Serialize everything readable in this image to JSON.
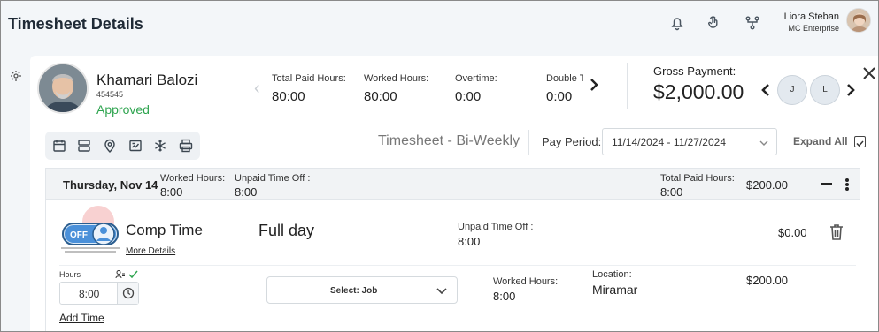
{
  "header": {
    "title": "Timesheet Details",
    "icons": [
      "bell-icon",
      "touch-icon",
      "workflow-icon"
    ],
    "user": {
      "name": "Liora Steban",
      "org": "MC Enterprise"
    }
  },
  "employee": {
    "name": "Khamari Balozi",
    "id": "454545",
    "status": "Approved",
    "status_color": "#2ea44f"
  },
  "stats": [
    {
      "label": "Total Paid Hours:",
      "value": "80:00"
    },
    {
      "label": "Worked Hours:",
      "value": "80:00"
    },
    {
      "label": "Overtime:",
      "value": "0:00"
    },
    {
      "label": "Double T",
      "value": "0:00"
    }
  ],
  "gross": {
    "label": "Gross Payment:",
    "value": "$2,000.00"
  },
  "nav_pills": [
    "J",
    "L"
  ],
  "toolbar": {
    "icons": [
      "calendar-icon",
      "layout-icon",
      "location-icon",
      "report-icon",
      "snowflake-icon",
      "print-icon"
    ]
  },
  "timesheet": {
    "type": "Timesheet - Bi-Weekly",
    "pay_period_label": "Pay Period:",
    "pay_period_value": "11/14/2024 - 11/27/2024",
    "expand_all_label": "Expand All"
  },
  "day": {
    "date": "Thursday, Nov 14",
    "worked_label": "Worked Hours:",
    "worked_value": "8:00",
    "unpaid_label": "Unpaid Time Off :",
    "unpaid_value": "8:00",
    "total_paid_label": "Total Paid Hours:",
    "total_paid_value": "8:00",
    "amount": "$200.00"
  },
  "entry": {
    "badge": "OFF",
    "type": "Comp Time",
    "more_details": "More Details",
    "duration": "Full day",
    "unpaid_label": "Unpaid Time Off :",
    "unpaid_value": "8:00",
    "amount": "$0.00"
  },
  "row": {
    "hours_label": "Hours",
    "hours_value": "8:00",
    "job_placeholder": "Select: Job",
    "worked_label": "Worked Hours:",
    "worked_value": "8:00",
    "location_label": "Location:",
    "location_value": "Miramar",
    "amount": "$200.00",
    "add_time": "Add Time"
  }
}
